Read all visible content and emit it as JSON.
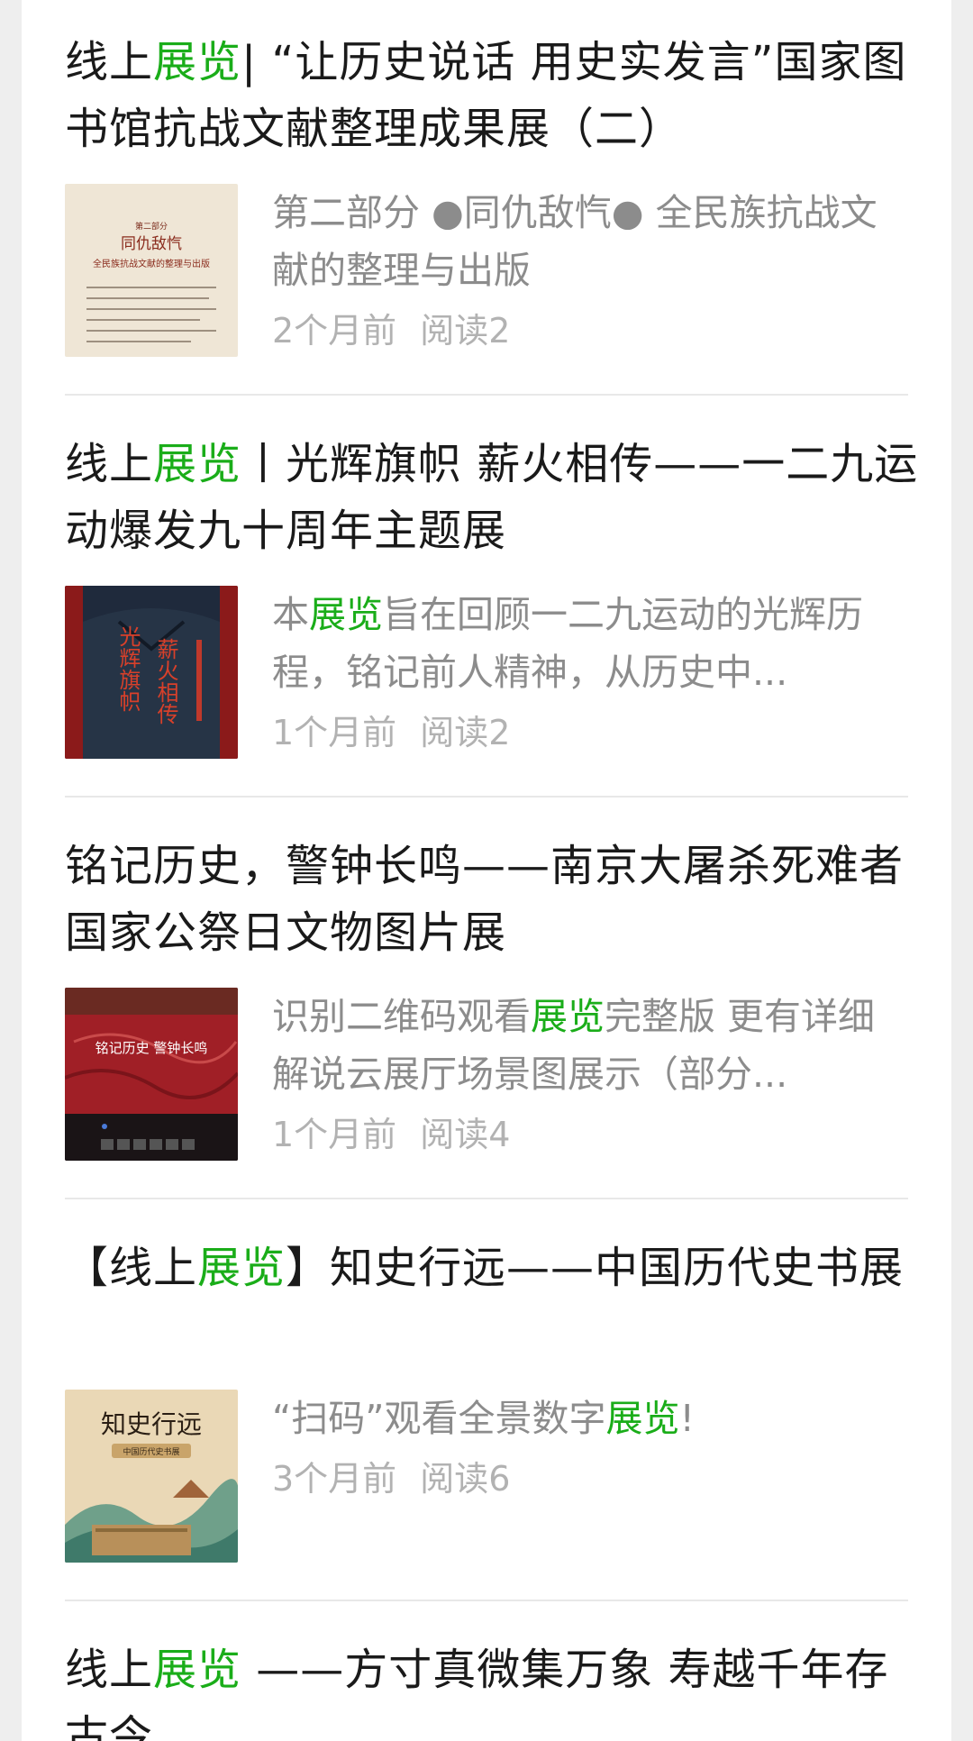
{
  "articles": [
    {
      "title_parts": [
        {
          "text": "线上",
          "hl": false
        },
        {
          "text": "展览",
          "hl": true
        },
        {
          "text": "| “让历史说话 用史实发言”国家图书馆抗战文献整理成果展（二）",
          "hl": false
        }
      ],
      "summary_parts": [
        {
          "text": "第二部分 ●同仇敌忾● 全民族抗战文献的整理与出版",
          "hl": false
        }
      ],
      "time": "2个月前",
      "reads": "阅读2",
      "thumb_text": {
        "line1": "第二部分",
        "line2": "同仇敌忾",
        "line3": "全民族抗战文献的整理与出版"
      }
    },
    {
      "title_parts": [
        {
          "text": "线上",
          "hl": false
        },
        {
          "text": "展览",
          "hl": true
        },
        {
          "text": "丨光辉旗帜 薪火相传——一二九运动爆发九十周年主题展",
          "hl": false
        }
      ],
      "summary_parts": [
        {
          "text": "本",
          "hl": false
        },
        {
          "text": "展览",
          "hl": true
        },
        {
          "text": "旨在回顾一二九运动的光辉历程，铭记前人精神，从历史中...",
          "hl": false
        }
      ],
      "time": "1个月前",
      "reads": "阅读2",
      "thumb_text": {
        "col1": "光辉旗帜",
        "col2": "薪火相传"
      }
    },
    {
      "title_parts": [
        {
          "text": "铭记历史，警钟长鸣——南京大屠杀死难者国家公祭日文物图片展",
          "hl": false
        }
      ],
      "summary_parts": [
        {
          "text": "识别二维码观看",
          "hl": false
        },
        {
          "text": "展览",
          "hl": true
        },
        {
          "text": "完整版 更有详细解说云展厅场景图展示（部分...",
          "hl": false
        }
      ],
      "time": "1个月前",
      "reads": "阅读4",
      "thumb_text": {
        "line1": "铭记历史 警钟长鸣"
      }
    },
    {
      "title_parts": [
        {
          "text": "【线上",
          "hl": false
        },
        {
          "text": "展览",
          "hl": true
        },
        {
          "text": "】知史行远——中国历代史书展",
          "hl": false
        }
      ],
      "summary_parts": [
        {
          "text": "“扫码”观看全景数字",
          "hl": false
        },
        {
          "text": "展览",
          "hl": true
        },
        {
          "text": "!",
          "hl": false
        }
      ],
      "time": "3个月前",
      "reads": "阅读6",
      "thumb_text": {
        "line1": "知史行远",
        "line2": "中国历代史书展"
      }
    },
    {
      "title_parts": [
        {
          "text": "线上",
          "hl": false
        },
        {
          "text": "展览",
          "hl": true
        },
        {
          "text": " ——方寸真微集万象 寿越千年存古今",
          "hl": false
        }
      ]
    }
  ],
  "colors": {
    "highlight": "#1aad19",
    "title": "#1a1a1a",
    "summary": "#8c8c8c",
    "meta": "#b2b2b2"
  }
}
